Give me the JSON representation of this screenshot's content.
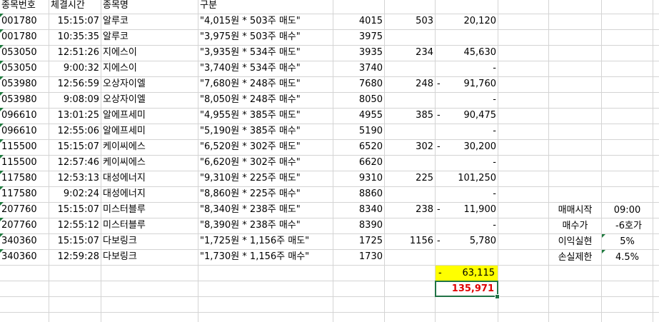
{
  "header": {
    "code": "종목번호",
    "time": "체결시간",
    "name": "종목명",
    "desc": "구분"
  },
  "rows": [
    {
      "code": "001780",
      "time": "15:15:07",
      "name": "알루코",
      "desc": "\"4,015원 * 503주 매도\"",
      "price": "4015",
      "qty": "503",
      "dash": "",
      "amount": "20,120"
    },
    {
      "code": "001780",
      "time": "10:35:35",
      "name": "알루코",
      "desc": "\"3,975원 * 503주 매수\"",
      "price": "3975",
      "qty": "",
      "dash": "",
      "amount": ""
    },
    {
      "code": "053050",
      "time": "12:51:26",
      "name": "지에스이",
      "desc": "\"3,935원 * 534주 매도\"",
      "price": "3935",
      "qty": "234",
      "dash": "",
      "amount": "45,630"
    },
    {
      "code": "053050",
      "time": "9:00:32",
      "name": "지에스이",
      "desc": "\"3,740원 * 534주 매수\"",
      "price": "3740",
      "qty": "",
      "dash": "",
      "amount": "-"
    },
    {
      "code": "053980",
      "time": "12:56:59",
      "name": "오상자이엘",
      "desc": "\"7,680원 * 248주 매도\"",
      "price": "7680",
      "qty": "248",
      "dash": "-",
      "amount": "91,760"
    },
    {
      "code": "053980",
      "time": "9:08:09",
      "name": "오상자이엘",
      "desc": "\"8,050원 * 248주 매수\"",
      "price": "8050",
      "qty": "",
      "dash": "",
      "amount": "-"
    },
    {
      "code": "096610",
      "time": "13:01:25",
      "name": "알에프세미",
      "desc": "\"4,955원 * 385주 매도\"",
      "price": "4955",
      "qty": "385",
      "dash": "-",
      "amount": "90,475"
    },
    {
      "code": "096610",
      "time": "12:55:06",
      "name": "알에프세미",
      "desc": "\"5,190원 * 385주 매수\"",
      "price": "5190",
      "qty": "",
      "dash": "",
      "amount": "-"
    },
    {
      "code": "115500",
      "time": "15:15:07",
      "name": "케이씨에스",
      "desc": "\"6,520원 * 302주 매도\"",
      "price": "6520",
      "qty": "302",
      "dash": "-",
      "amount": "30,200"
    },
    {
      "code": "115500",
      "time": "12:57:46",
      "name": "케이씨에스",
      "desc": "\"6,620원 * 302주 매수\"",
      "price": "6620",
      "qty": "",
      "dash": "",
      "amount": "-"
    },
    {
      "code": "117580",
      "time": "12:53:13",
      "name": "대성에너지",
      "desc": "\"9,310원 * 225주 매도\"",
      "price": "9310",
      "qty": "225",
      "dash": "",
      "amount": "101,250"
    },
    {
      "code": "117580",
      "time": "9:02:24",
      "name": "대성에너지",
      "desc": "\"8,860원 * 225주 매수\"",
      "price": "8860",
      "qty": "",
      "dash": "",
      "amount": "-"
    },
    {
      "code": "207760",
      "time": "15:15:07",
      "name": "미스터블루",
      "desc": "\"8,340원 * 238주 매도\"",
      "price": "8340",
      "qty": "238",
      "dash": "-",
      "amount": "11,900"
    },
    {
      "code": "207760",
      "time": "12:55:12",
      "name": "미스터블루",
      "desc": "\"8,390원 * 238주 매수\"",
      "price": "8390",
      "qty": "",
      "dash": "",
      "amount": "-"
    },
    {
      "code": "340360",
      "time": "15:15:07",
      "name": "다보링크",
      "desc": "\"1,725원 * 1,156주 매도\"",
      "price": "1725",
      "qty": "1156",
      "dash": "-",
      "amount": "5,780"
    },
    {
      "code": "340360",
      "time": "12:59:28",
      "name": "다보링크",
      "desc": "\"1,730원 * 1,156주 매수\"",
      "price": "1730",
      "qty": "",
      "dash": "",
      "amount": ""
    }
  ],
  "totals": {
    "dash": "-",
    "sum": "63,115",
    "grand": "135,971"
  },
  "settings": [
    {
      "label": "매매시작",
      "value": "09:00"
    },
    {
      "label": "매수가",
      "value": "-6호가"
    },
    {
      "label": "이익실현",
      "value": "5%"
    },
    {
      "label": "손실제한",
      "value": "4.5%"
    }
  ],
  "colors": {
    "highlight": "#ffff00",
    "total_text": "#e00000",
    "selection": "#217346",
    "gridline": "#d4d4d4"
  }
}
